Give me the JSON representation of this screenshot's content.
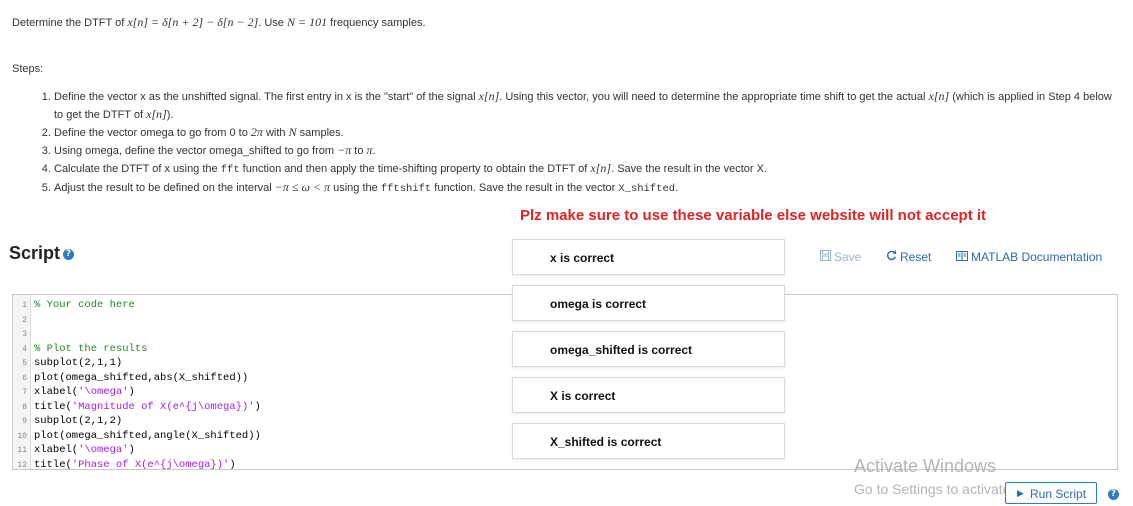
{
  "problem": {
    "prefix": "Determine the DTFT of ",
    "signal_math": "x[n] = δ[n + 2] − δ[n − 2]",
    "middle": ". Use ",
    "n_math": "N = 101",
    "suffix": " frequency samples."
  },
  "steps_heading": "Steps:",
  "steps": {
    "s1": {
      "a": "Define the vector x as the unshifted signal. The first entry in x is the \"start\" of the signal ",
      "m1": "x[n]",
      "b": ". Using this vector, you will need to determine the appropriate time shift to get the actual ",
      "m2": "x[n]",
      "c": " (which is applied in Step 4 below to get the DTFT of ",
      "m3": "x[n]",
      "d": ")."
    },
    "s2": {
      "a": "Define the vector omega to go from 0 to ",
      "m1": "2π",
      "b": " with ",
      "m2": "N",
      "c": " samples."
    },
    "s3": {
      "a": "Using omega, define the vector omega_shifted to go from ",
      "m1": "−π",
      "b": " to ",
      "m2": "π",
      "c": "."
    },
    "s4": {
      "a": "Calculate the DTFT of x using the ",
      "code1": "fft",
      "b": " function and then apply the time-shifting property to obtain the DTFT of ",
      "m1": "x[n]",
      "c": ". Save the result in the vector X."
    },
    "s5": {
      "a": "Adjust the result to be defined on the interval ",
      "m1": "−π ≤ ω < π",
      "b": " using the ",
      "code1": "fftshift",
      "c": " function. Save the result in the vector ",
      "code2": "X_shifted",
      "d": "."
    }
  },
  "warning": "Plz make sure to use these variable else website will not accept it",
  "script": {
    "heading": "Script",
    "help_icon": "?",
    "toolbar": {
      "save": "Save",
      "reset": "Reset",
      "docs": "MATLAB Documentation"
    }
  },
  "code_lines": [
    {
      "n": "1",
      "text": "% Your code here",
      "kind": "comment"
    },
    {
      "n": "2",
      "text": "",
      "kind": "plain"
    },
    {
      "n": "3",
      "text": "",
      "kind": "plain"
    },
    {
      "n": "4",
      "text": "% Plot the results",
      "kind": "comment"
    },
    {
      "n": "5",
      "text": "subplot(2,1,1)",
      "kind": "plain"
    },
    {
      "n": "6",
      "text": "plot(omega_shifted,abs(X_shifted))",
      "kind": "plain"
    },
    {
      "n": "7",
      "pre": "xlabel(",
      "str": "'\\omega'",
      "post": ")",
      "kind": "mixed"
    },
    {
      "n": "8",
      "pre": "title(",
      "str": "'Magnitude of X(e^{j\\omega})'",
      "post": ")",
      "kind": "mixed"
    },
    {
      "n": "9",
      "text": "subplot(2,1,2)",
      "kind": "plain"
    },
    {
      "n": "10",
      "text": "plot(omega_shifted,angle(X_shifted))",
      "kind": "plain"
    },
    {
      "n": "11",
      "pre": "xlabel(",
      "str": "'\\omega'",
      "post": ")",
      "kind": "mixed"
    },
    {
      "n": "12",
      "pre": "title(",
      "str": "'Phase of X(e^{j\\omega})'",
      "post": ")",
      "kind": "mixed"
    }
  ],
  "checks": [
    "x is correct",
    "omega is correct",
    "omega_shifted is correct",
    "X is correct",
    "X_shifted is correct"
  ],
  "watermark": {
    "title": "Activate Windows",
    "subtitle": "Go to Settings to activate Windows."
  },
  "run_button": {
    "label": "Run Script",
    "icon": "play-icon"
  },
  "colors": {
    "accent": "#2d7bc4",
    "warning": "#e02424",
    "comment": "#228b22",
    "string": "#a020f0"
  }
}
